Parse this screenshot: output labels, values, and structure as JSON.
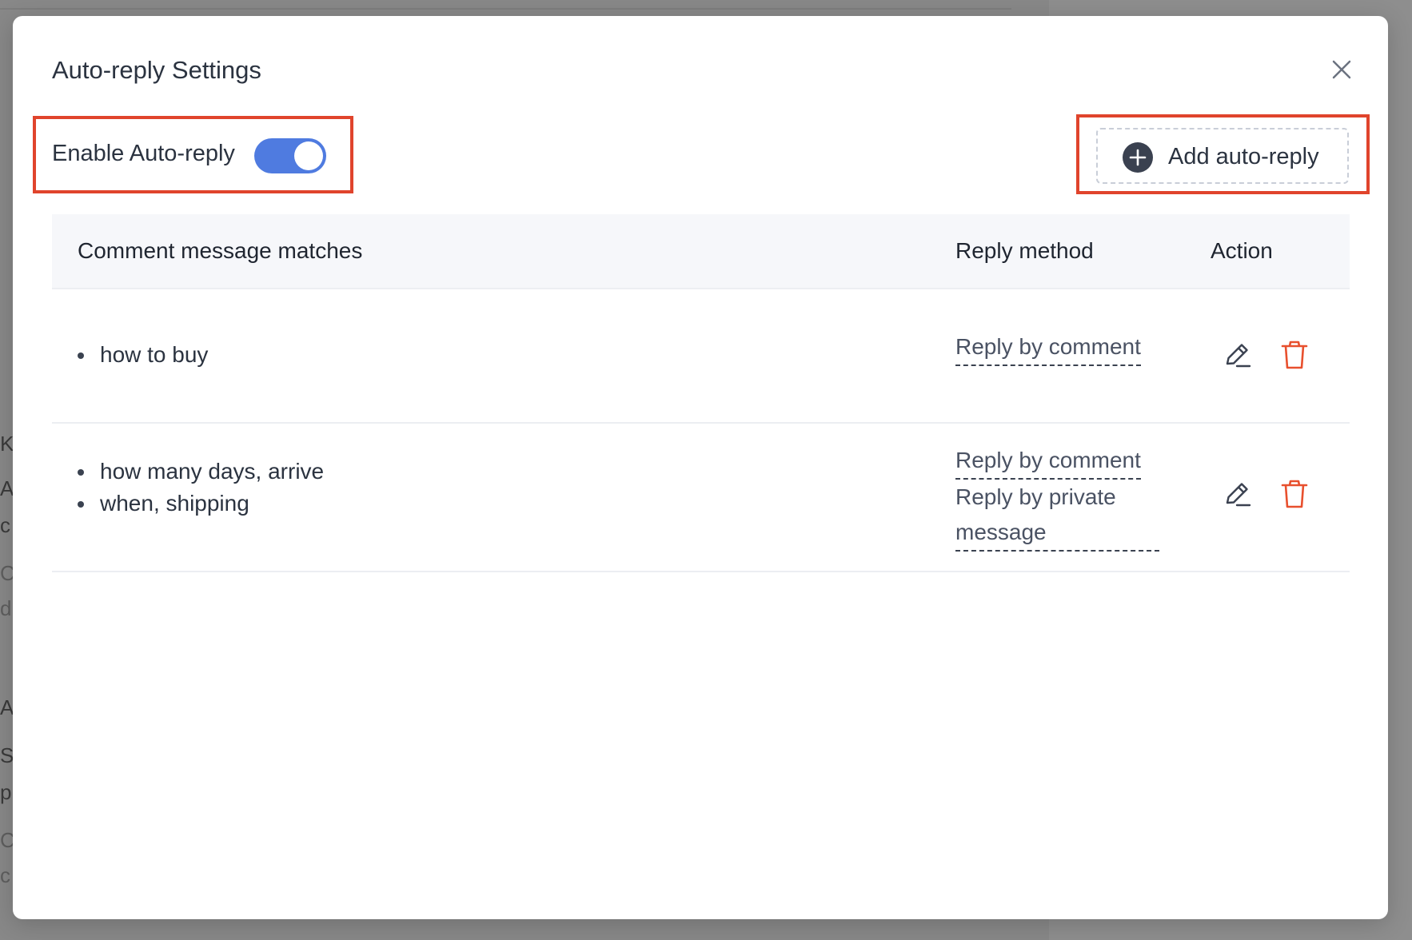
{
  "modal": {
    "title": "Auto-reply Settings"
  },
  "toggle": {
    "label": "Enable Auto-reply",
    "enabled": true
  },
  "add_button": {
    "label": "Add auto-reply"
  },
  "table": {
    "headers": {
      "match": "Comment message matches",
      "method": "Reply method",
      "action": "Action"
    },
    "rows": [
      {
        "matches": [
          "how to buy"
        ],
        "methods": [
          "Reply by comment"
        ]
      },
      {
        "matches": [
          "how many days, arrive",
          "when, shipping"
        ],
        "methods": [
          "Reply by comment",
          "Reply by private message"
        ]
      }
    ]
  },
  "background": {
    "letters": [
      "K",
      "A",
      "c",
      "C",
      "d",
      "A",
      "S",
      "p",
      "C",
      "c"
    ]
  },
  "colors": {
    "toggle_on": "#4f7be0",
    "highlight": "#e0442c",
    "delete": "#e8502e",
    "text": "#2b3340"
  }
}
